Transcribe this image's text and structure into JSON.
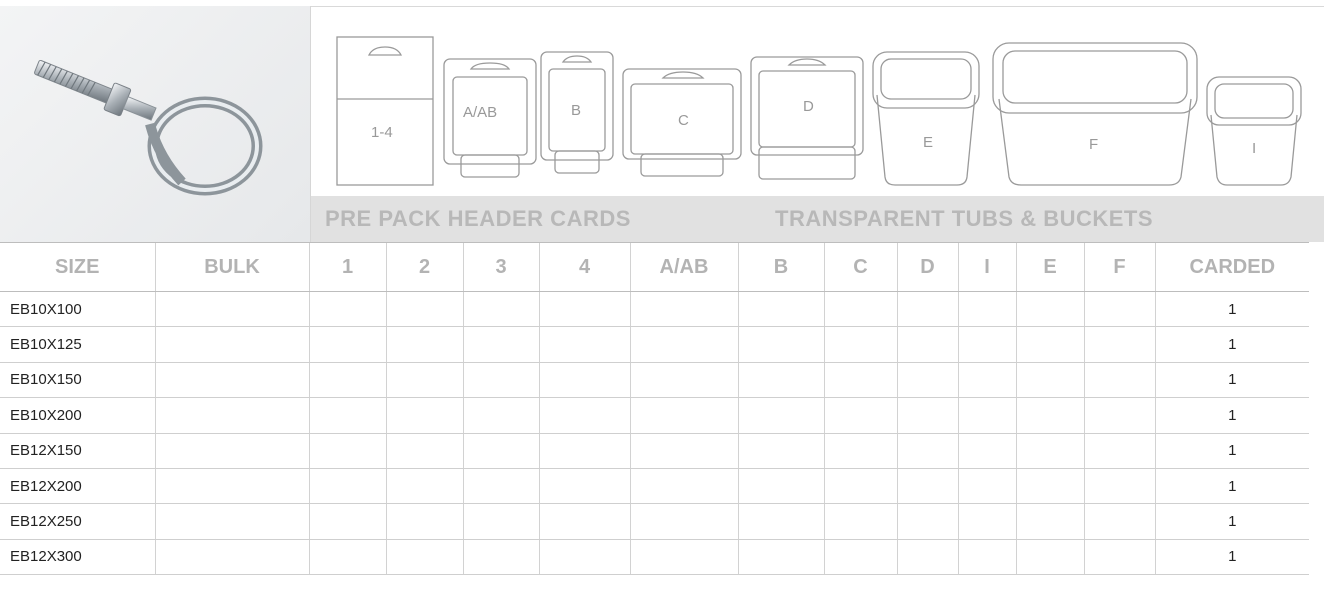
{
  "product": {
    "image_name": "eye-bolt-photo"
  },
  "pack_icons": [
    "1-4",
    "A/AB",
    "B",
    "C",
    "D",
    "E",
    "F",
    "I"
  ],
  "bands": {
    "pre_pack": "PRE PACK HEADER CARDS",
    "tubs": "TRANSPARENT TUBS & BUCKETS"
  },
  "table": {
    "headers": [
      "SIZE",
      "BULK",
      "1",
      "2",
      "3",
      "4",
      "A/AB",
      "B",
      "C",
      "D",
      "I",
      "E",
      "F",
      "CARDED"
    ],
    "rows": [
      {
        "size": "EB10X100",
        "carded": "1"
      },
      {
        "size": "EB10X125",
        "carded": "1"
      },
      {
        "size": "EB10X150",
        "carded": "1"
      },
      {
        "size": "EB10X200",
        "carded": "1"
      },
      {
        "size": "EB12X150",
        "carded": "1"
      },
      {
        "size": "EB12X200",
        "carded": "1"
      },
      {
        "size": "EB12X250",
        "carded": "1"
      },
      {
        "size": "EB12X300",
        "carded": "1"
      }
    ]
  },
  "colors": {
    "header_text": "#b3b3b3",
    "band_bg": "#e1e1e1",
    "line": "#d2d2d2",
    "icon_stroke": "#9a9a9a"
  }
}
